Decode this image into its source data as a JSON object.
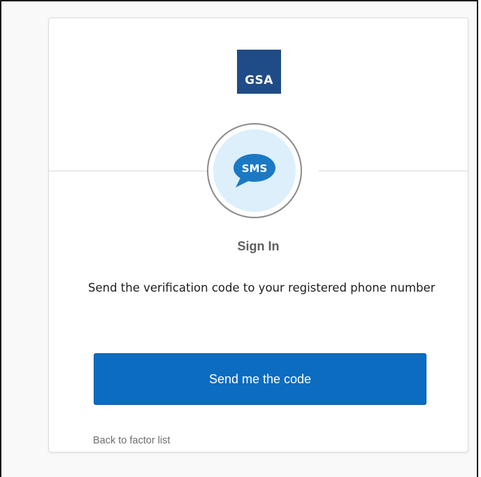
{
  "brand": {
    "logo_text": "GSA",
    "logo_color": "#1f4c86"
  },
  "factor": {
    "icon": "sms-icon",
    "icon_text": "SMS",
    "icon_color": "#1b79c4",
    "beacon_bg": "#dceffb"
  },
  "form": {
    "heading": "Sign In",
    "subtitle": "Send the verification code to your registered phone number",
    "submit_label": "Send me the code",
    "submit_color": "#0b6cc0",
    "back_link_label": "Back to factor list"
  }
}
